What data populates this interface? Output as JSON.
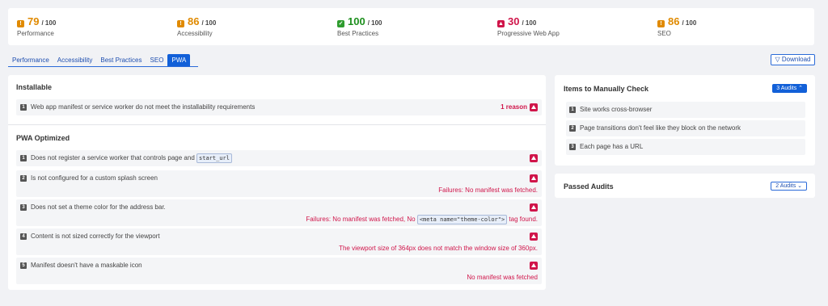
{
  "scores": [
    {
      "value": "79",
      "den": "/ 100",
      "label": "Performance",
      "color": "#e08a00",
      "badge": "!"
    },
    {
      "value": "86",
      "den": "/ 100",
      "label": "Accessibility",
      "color": "#e08a00",
      "badge": "!"
    },
    {
      "value": "100",
      "den": "/ 100",
      "label": "Best Practices",
      "color": "#2e9c2e",
      "badge": "✓"
    },
    {
      "value": "30",
      "den": "/ 100",
      "label": "Progressive Web App",
      "color": "#d0154a",
      "badge": "▲"
    },
    {
      "value": "86",
      "den": "/ 100",
      "label": "SEO",
      "color": "#e08a00",
      "badge": "!"
    }
  ],
  "tabs": [
    "Performance",
    "Accessibility",
    "Best Practices",
    "SEO",
    "PWA"
  ],
  "download_label": "▽ Download",
  "installable": {
    "title": "Installable",
    "audit": {
      "index": "1",
      "text": "Web app manifest or service worker do not meet the installability requirements",
      "reason": "1 reason"
    }
  },
  "pwa": {
    "title": "PWA Optimized",
    "audits": [
      {
        "index": "1",
        "text": "Does not register a service worker that controls page and",
        "code": "start_url"
      },
      {
        "index": "2",
        "text": "Is not configured for a custom splash screen",
        "fail": "Failures: No manifest was fetched."
      },
      {
        "index": "3",
        "text": "Does not set a theme color for the address bar.",
        "fail_pre": "Failures: No manifest was fetched, No",
        "fail_code": "<meta name=\"theme-color\">",
        "fail_post": "tag found."
      },
      {
        "index": "4",
        "text": "Content is not sized correctly for the viewport",
        "fail": "The viewport size of 364px does not match the window size of 360px."
      },
      {
        "index": "5",
        "text": "Manifest doesn't have a maskable icon",
        "fail": "No manifest was fetched"
      }
    ]
  },
  "manual": {
    "title": "Items to Manually Check",
    "count": "3 Audits ⌃",
    "items": [
      {
        "index": "1",
        "text": "Site works cross-browser"
      },
      {
        "index": "2",
        "text": "Page transitions don't feel like they block on the network"
      },
      {
        "index": "3",
        "text": "Each page has a URL"
      }
    ]
  },
  "passed": {
    "title": "Passed Audits",
    "count": "2 Audits ⌄"
  }
}
